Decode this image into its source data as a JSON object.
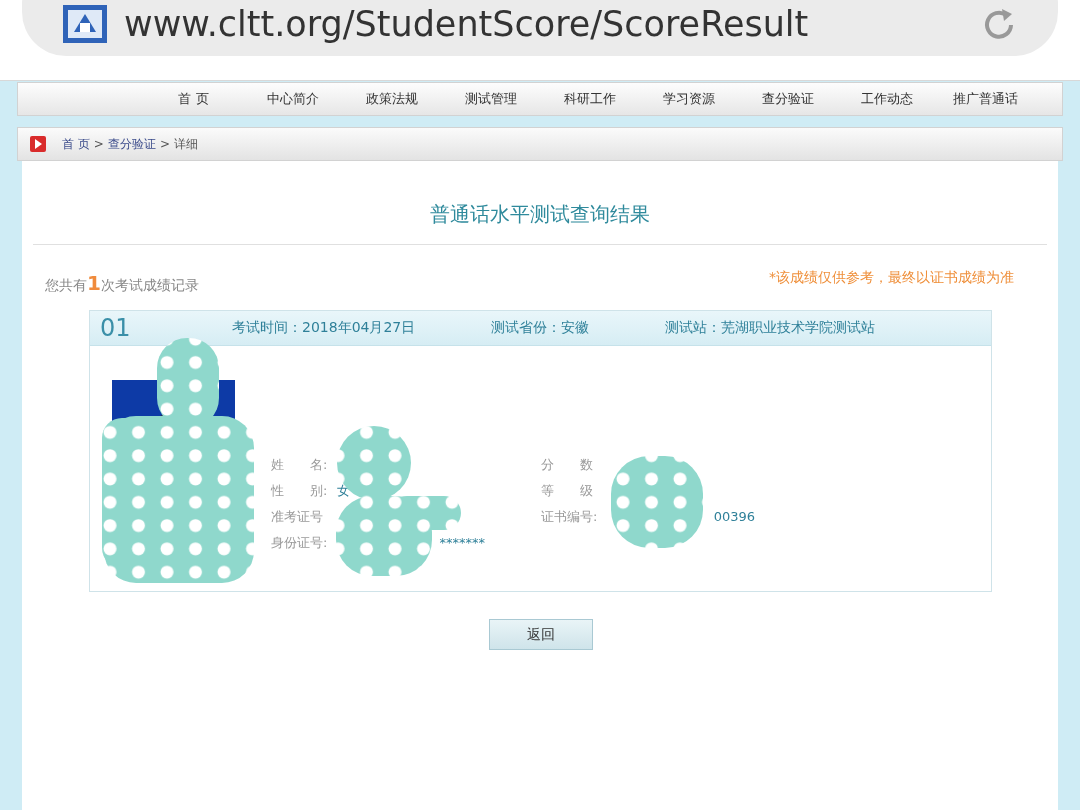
{
  "browser": {
    "url": "www.cltt.org/StudentScore/ScoreResult"
  },
  "nav": {
    "items": [
      {
        "label": "首 页"
      },
      {
        "label": "中心简介"
      },
      {
        "label": "政策法规"
      },
      {
        "label": "测试管理"
      },
      {
        "label": "科研工作"
      },
      {
        "label": "学习资源"
      },
      {
        "label": "查分验证"
      },
      {
        "label": "工作动态"
      },
      {
        "label": "推广普通话"
      }
    ]
  },
  "breadcrumb": [
    {
      "label": "首 页",
      "kind": "link"
    },
    {
      "label": ">",
      "kind": "sep"
    },
    {
      "label": "查分验证",
      "kind": "link"
    },
    {
      "label": ">",
      "kind": "sep"
    },
    {
      "label": "详细",
      "kind": "current"
    }
  ],
  "title": "普通话水平测试查询结果",
  "summary": {
    "prefix": "您共有",
    "count": "1",
    "suffix": "次考试成绩记录"
  },
  "note": "*该成绩仅供参考，最终以证书成绩为准",
  "record": {
    "index": "01",
    "date": "考试时间：2018年04月27日",
    "province": "测试省份：安徽",
    "station": "测试站：芜湖职业技术学院测试站",
    "left_fields": [
      {
        "label": "姓　　名:",
        "kind": "plain"
      },
      {
        "label": "性　　别:",
        "value": "女",
        "kind": "plain"
      },
      {
        "label": "准考证号",
        "kind": "plain"
      },
      {
        "label": "身份证号:",
        "value": "*******",
        "kind": "tail"
      }
    ],
    "right_fields": [
      {
        "label": "分　　数",
        "kind": "plain"
      },
      {
        "label": "等　　级",
        "kind": "plain"
      },
      {
        "label": "证书编号:",
        "value": "00396",
        "kind": "tail"
      }
    ]
  },
  "button": "返回"
}
